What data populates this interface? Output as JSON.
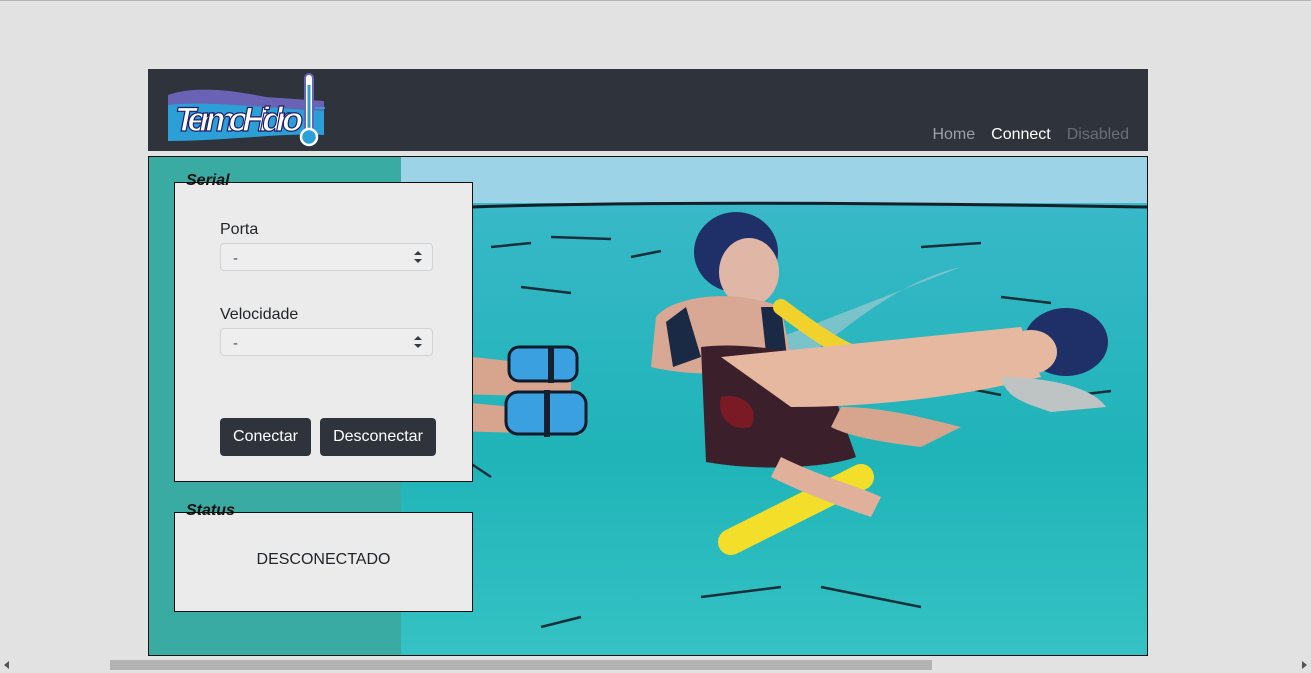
{
  "logo": {
    "text_1": "Termo",
    "text_2": "Hidro"
  },
  "nav": {
    "home": "Home",
    "connect": "Connect",
    "disabled": "Disabled"
  },
  "serial": {
    "legend": "Serial",
    "porta_label": "Porta",
    "porta_value": "-",
    "velocidade_label": "Velocidade",
    "velocidade_value": "-",
    "connect_button": "Conectar",
    "disconnect_button": "Desconectar"
  },
  "status": {
    "legend": "Status",
    "value": "DESCONECTADO"
  },
  "icons": {
    "select_arrows": "up-down-chevron-icon",
    "scroll_left": "arrow-left-icon",
    "scroll_right": "arrow-right-icon"
  },
  "colors": {
    "navbar": "#2f333b",
    "panel_bg": "#3aaba3",
    "button": "#2f333b"
  }
}
